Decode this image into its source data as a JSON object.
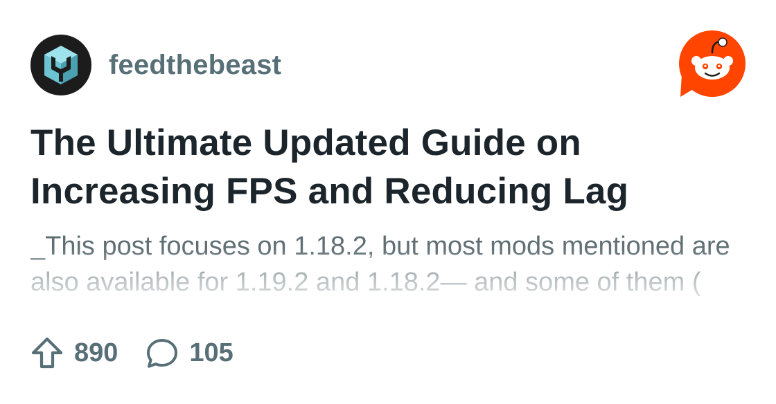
{
  "subreddit": {
    "name": "feedthebeast",
    "avatar_icon": "ftb-logo-icon"
  },
  "brand": {
    "logo_icon": "reddit-snoo-icon",
    "accent_color": "#ff4500"
  },
  "post": {
    "title": "The Ultimate Updated Guide on Increasing FPS and Reducing Lag",
    "body_preview": "_This post focuses on 1.18.2, but most mods mentioned are also available for 1.19.2 and 1.18.2— and some of them (",
    "upvotes": "890",
    "comments": "105",
    "upvote_icon": "upvote-arrow-icon",
    "comment_icon": "comment-bubble-icon"
  }
}
